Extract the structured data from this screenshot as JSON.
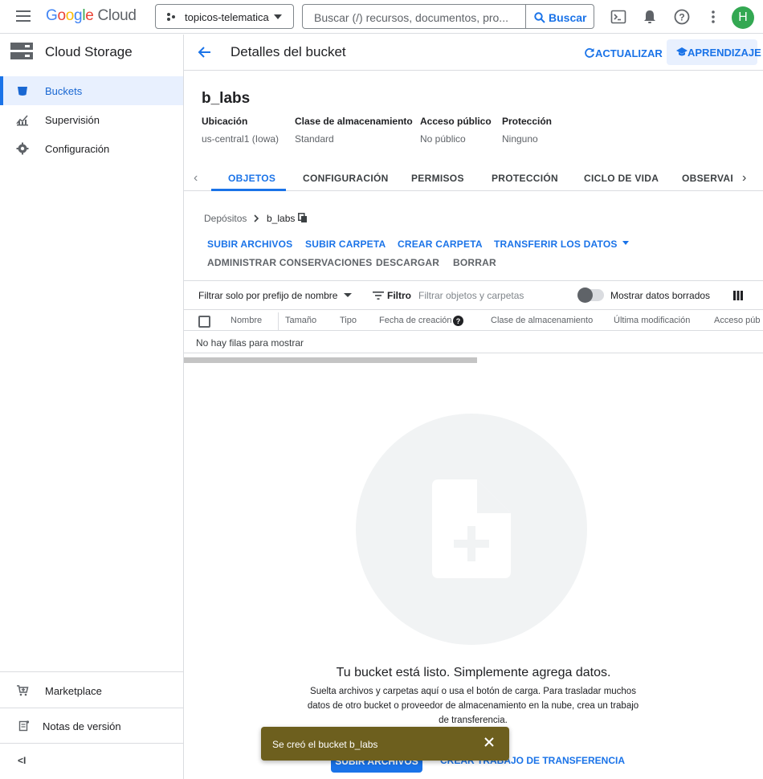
{
  "topbar": {
    "logo_google": "Google",
    "logo_cloud": "Cloud",
    "project": "topicos-telematica",
    "search_placeholder": "Buscar (/) recursos, documentos, pro...",
    "search_button": "Buscar",
    "avatar_initial": "H"
  },
  "sidebar": {
    "title": "Cloud Storage",
    "items": [
      {
        "label": "Buckets",
        "icon": "bucket-icon",
        "active": true
      },
      {
        "label": "Supervisión",
        "icon": "monitoring-icon"
      },
      {
        "label": "Configuración",
        "icon": "settings-icon"
      }
    ],
    "footer": [
      {
        "label": "Marketplace",
        "icon": "cart-icon"
      },
      {
        "label": "Notas de versión",
        "icon": "notes-icon"
      }
    ],
    "collapse_label": "<I"
  },
  "header": {
    "title": "Detalles del bucket",
    "refresh": "ACTUALIZAR",
    "learn": "APRENDIZAJE"
  },
  "bucket": {
    "name": "b_labs",
    "meta": [
      {
        "label": "Ubicación",
        "value": "us-central1 (Iowa)"
      },
      {
        "label": "Clase de almacenamiento",
        "value": "Standard"
      },
      {
        "label": "Acceso público",
        "value": "No público"
      },
      {
        "label": "Protección",
        "value": "Ninguno"
      }
    ]
  },
  "tabs": [
    "OBJETOS",
    "CONFIGURACIÓN",
    "PERMISOS",
    "PROTECCIÓN",
    "CICLO DE VIDA",
    "OBSERVABI"
  ],
  "breadcrumb": {
    "root": "Depósitos",
    "current": "b_labs"
  },
  "actions": {
    "upload_files": "SUBIR ARCHIVOS",
    "upload_folder": "SUBIR CARPETA",
    "create_folder": "CREAR CARPETA",
    "transfer": "TRANSFERIR LOS DATOS",
    "manage_holds": "ADMINISTRAR CONSERVACIONES",
    "download": "DESCARGAR",
    "delete": "BORRAR"
  },
  "filter": {
    "prefix": "Filtrar solo por prefijo de nombre",
    "filter_label": "Filtro",
    "filter_placeholder": "Filtrar objetos y carpetas",
    "show_deleted": "Mostrar datos borrados"
  },
  "table": {
    "columns": [
      "Nombre",
      "Tamaño",
      "Tipo",
      "Fecha de creación",
      "Clase de almacenamiento",
      "Última modificación",
      "Acceso púb"
    ],
    "empty": "No hay filas para mostrar"
  },
  "empty_state": {
    "title": "Tu bucket está listo. Simplemente agrega datos.",
    "description": "Suelta archivos y carpetas aquí o usa el botón de carga. Para trasladar muchos datos de otro bucket o proveedor de almacenamiento en la nube, crea un trabajo de transferencia.",
    "upload_button": "SUBIR ARCHIVOS",
    "transfer_link_prefix": "CREAR TRABAJO DE ",
    "transfer_link": "TRANSFERENCIA"
  },
  "snackbar": {
    "message": "Se creó el bucket b_labs"
  },
  "colors": {
    "accent": "#1a73e8",
    "snackbar": "#6d5f1e",
    "avatar": "#33a852"
  }
}
